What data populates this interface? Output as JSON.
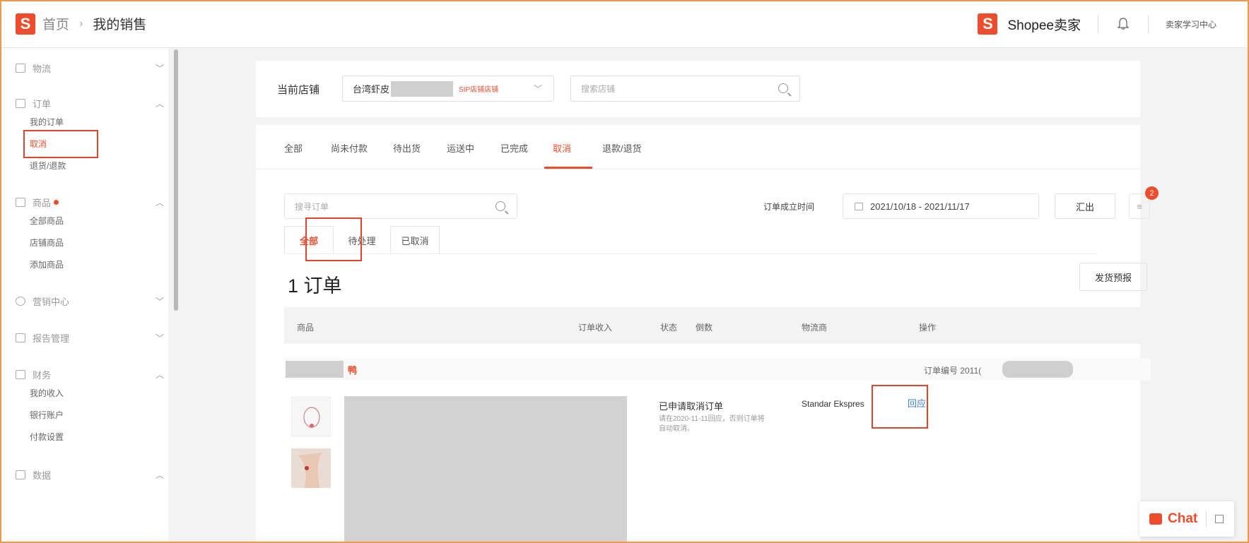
{
  "header": {
    "logo_letter": "S",
    "breadcrumb": {
      "home": "首页",
      "separator": "›",
      "current": "我的销售"
    },
    "brand": "Shopee卖家",
    "learning_center": "卖家学习中心"
  },
  "sidebar": {
    "groups": [
      {
        "label": "物流",
        "expanded": false,
        "items": []
      },
      {
        "label": "订单",
        "expanded": true,
        "items": [
          "我的订单",
          "取消",
          "退货/退款"
        ],
        "active_item": "取消"
      },
      {
        "label": "商品",
        "expanded": true,
        "has_dot": true,
        "items": [
          "全部商品",
          "店铺商品",
          "添加商品"
        ]
      },
      {
        "label": "营销中心",
        "expanded": false,
        "items": []
      },
      {
        "label": "报告管理",
        "expanded": false,
        "items": []
      },
      {
        "label": "财务",
        "expanded": true,
        "items": [
          "我的收入",
          "银行账户",
          "付款设置"
        ]
      },
      {
        "label": "数据",
        "expanded": true,
        "items": []
      }
    ]
  },
  "store_bar": {
    "label": "当前店铺",
    "store_name": "台湾虾皮",
    "store_tag": "SIP店铺店铺",
    "search_placeholder": "搜索店铺"
  },
  "tabs": [
    "全部",
    "尚未付款",
    "待出货",
    "运送中",
    "已完成",
    "取消",
    "退款/退货"
  ],
  "active_tab": "取消",
  "filters": {
    "search_placeholder": "搜寻订单",
    "date_label": "订单成立时间",
    "date_range": "2021/10/18 - 2021/11/17",
    "export_label": "汇出",
    "menu_icon": "≡",
    "badge_count": "2"
  },
  "subtabs": [
    "全部",
    "待处理",
    "已取消"
  ],
  "active_subtab": "全部",
  "summary": {
    "order_count": "1 订单",
    "ship_button": "发货预报"
  },
  "table": {
    "headers": [
      "商品",
      "订单收入",
      "状态",
      "倒数",
      "物流商",
      "操作"
    ]
  },
  "order": {
    "buyer_suffix": "鸭",
    "order_no_label": "订单编号 2011(",
    "status_title": "已申请取消订单",
    "status_desc": "请在2020-11-11回应，否则订单将自动取消。",
    "carrier": "Standar Ekspres",
    "action": "回应"
  },
  "chat": {
    "label": "Chat"
  },
  "colors": {
    "brand": "#ee4d2d",
    "link": "#3a7bd5",
    "highlight_box": "#e2452b",
    "frame": "#ee9a4d"
  }
}
